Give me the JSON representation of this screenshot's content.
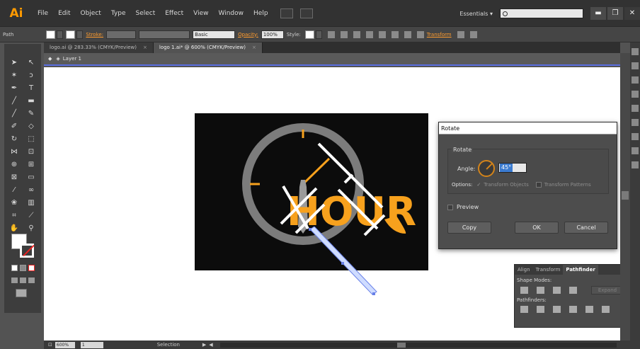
{
  "app": {
    "logo": "Ai",
    "menus": [
      "File",
      "Edit",
      "Object",
      "Type",
      "Select",
      "Effect",
      "View",
      "Window",
      "Help"
    ],
    "workspace": "Essentials",
    "workspace_arrow": "▾",
    "window_buttons": [
      "▬",
      "❐",
      "✕"
    ]
  },
  "control": {
    "selection_type": "Path",
    "stroke_label": "Stroke:",
    "brush_label": "Basic",
    "opacity_label": "Opacity:",
    "opacity_value": "100%",
    "style_label": "Style:",
    "transform_label": "Transform"
  },
  "tabs": [
    {
      "label": "logo.ai @ 283.33% (CMYK/Preview)",
      "close": "×"
    },
    {
      "label": "logo 1.ai* @ 600% (CMYK/Preview)",
      "close": "×"
    }
  ],
  "layer": {
    "label": "Layer 1"
  },
  "artwork": {
    "word": "HOUR",
    "accent_color": "#f7a11d",
    "ring_color": "#7c7c7c"
  },
  "status": {
    "zoom": "600%",
    "page": "1",
    "tool": "Selection",
    "nav_arrow": "◀",
    "play_arrow": "▶"
  },
  "rotate_dialog": {
    "title": "Rotate",
    "group_label": "Rotate",
    "angle_label": "Angle:",
    "angle_value": "45°",
    "options_label": "Options:",
    "transform_objects": "Transform Objects",
    "transform_patterns": "Transform Patterns",
    "preview_label": "Preview",
    "copy_button": "Copy",
    "ok_button": "OK",
    "cancel_button": "Cancel"
  },
  "pathfinder": {
    "tabs": [
      "Align",
      "Transform",
      "Pathfinder"
    ],
    "tab_menu": "▸▸",
    "shape_modes_label": "Shape Modes:",
    "pathfinders_label": "Pathfinders:",
    "expand_button": "Expand"
  },
  "colors": {
    "accent": "#f7a11d",
    "selection_blue": "#5a6ee0",
    "link_orange": "#ff9c2e"
  }
}
